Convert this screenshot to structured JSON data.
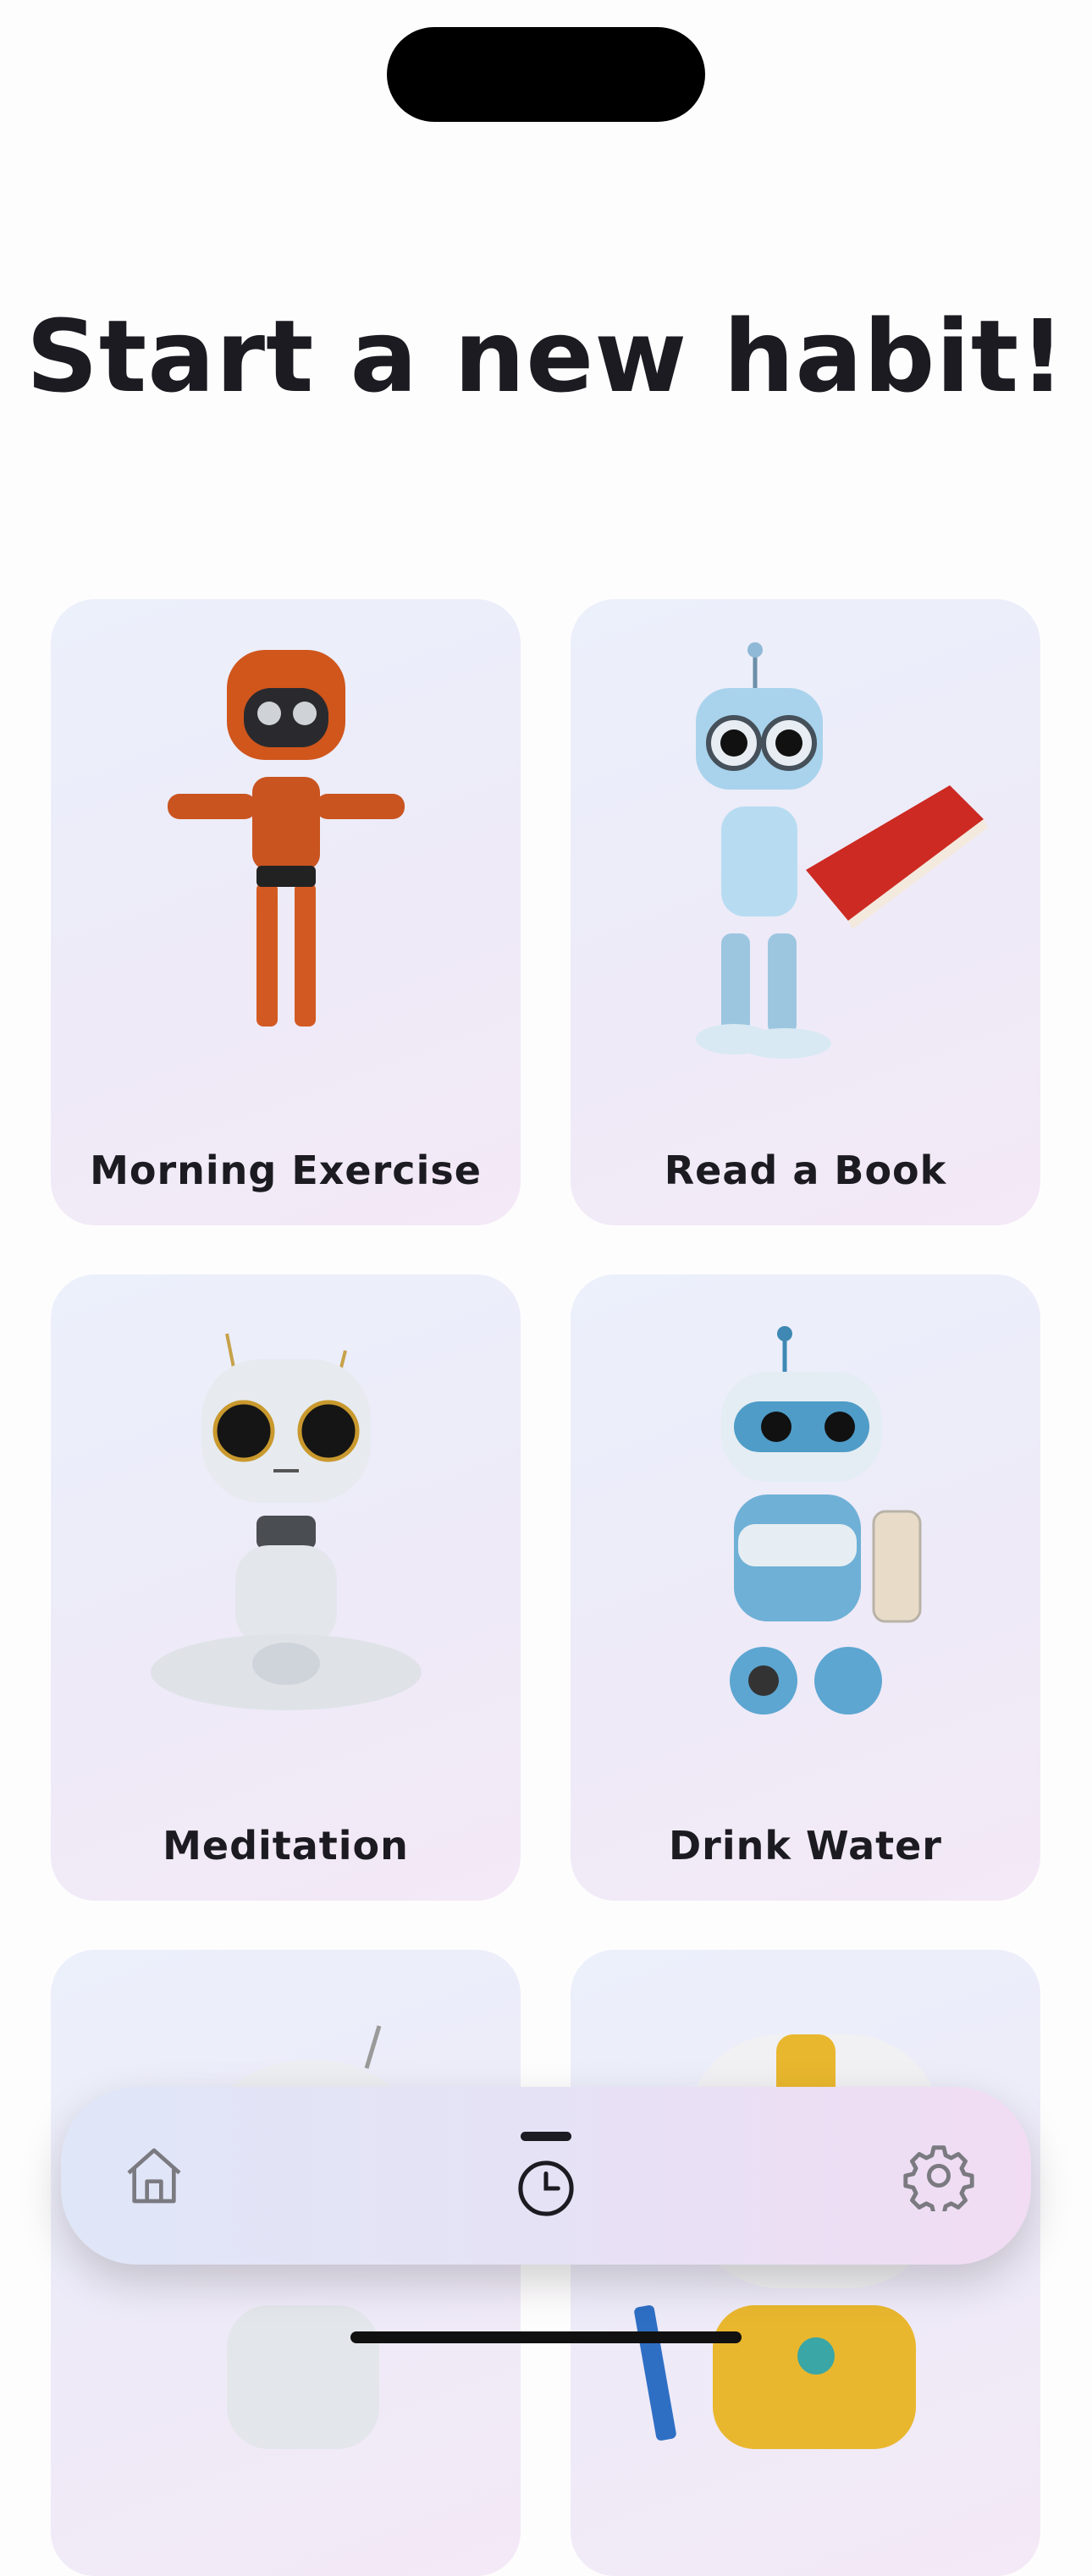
{
  "header": {
    "title": "Start a new habit!"
  },
  "habits": [
    {
      "label": "Morning Exercise",
      "image": "orange-robot-exercise"
    },
    {
      "label": "Read a Book",
      "image": "blue-robot-reading"
    },
    {
      "label": "Meditation",
      "image": "white-robot-meditating"
    },
    {
      "label": "Drink Water",
      "image": "blue-robot-drinking-water"
    },
    {
      "label": "",
      "image": "white-robot-partial"
    },
    {
      "label": "",
      "image": "yellow-robot-partial"
    }
  ],
  "tabbar": {
    "items": [
      {
        "name": "home",
        "icon": "home-icon"
      },
      {
        "name": "timer",
        "icon": "timer-icon",
        "active": true
      },
      {
        "name": "settings",
        "icon": "gear-icon"
      }
    ]
  },
  "colors": {
    "text": "#1c1b21",
    "card_start": "#ebf0fb",
    "card_end": "#f4e9f6",
    "icon_gray": "#7a7a80"
  }
}
